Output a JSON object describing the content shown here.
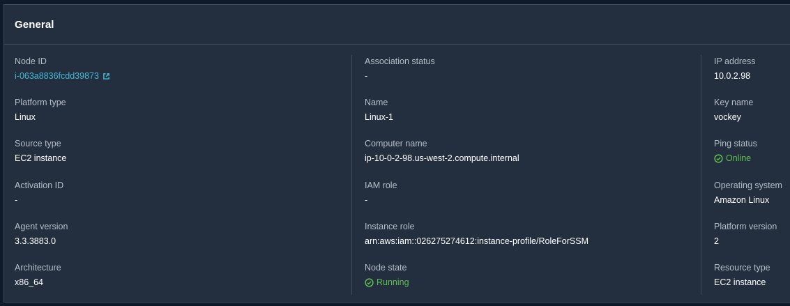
{
  "panel": {
    "title": "General"
  },
  "colors": {
    "link": "#44b9d6",
    "success": "#60bf4f",
    "background": "#232f3e"
  },
  "col1": {
    "node_id_label": "Node ID",
    "node_id_value": "i-063a8836fcdd39873",
    "platform_type_label": "Platform type",
    "platform_type_value": "Linux",
    "source_type_label": "Source type",
    "source_type_value": "EC2 instance",
    "activation_id_label": "Activation ID",
    "activation_id_value": "-",
    "agent_version_label": "Agent version",
    "agent_version_value": "3.3.3883.0",
    "architecture_label": "Architecture",
    "architecture_value": "x86_64"
  },
  "col2": {
    "association_status_label": "Association status",
    "association_status_value": "-",
    "name_label": "Name",
    "name_value": "Linux-1",
    "computer_name_label": "Computer name",
    "computer_name_value": "ip-10-0-2-98.us-west-2.compute.internal",
    "iam_role_label": "IAM role",
    "iam_role_value": "-",
    "instance_role_label": "Instance role",
    "instance_role_value": "arn:aws:iam::026275274612:instance-profile/RoleForSSM",
    "node_state_label": "Node state",
    "node_state_value": "Running"
  },
  "col3": {
    "ip_address_label": "IP address",
    "ip_address_value": "10.0.2.98",
    "key_name_label": "Key name",
    "key_name_value": "vockey",
    "ping_status_label": "Ping status",
    "ping_status_value": "Online",
    "operating_system_label": "Operating system",
    "operating_system_value": "Amazon Linux",
    "platform_version_label": "Platform version",
    "platform_version_value": "2",
    "resource_type_label": "Resource type",
    "resource_type_value": "EC2 instance"
  }
}
